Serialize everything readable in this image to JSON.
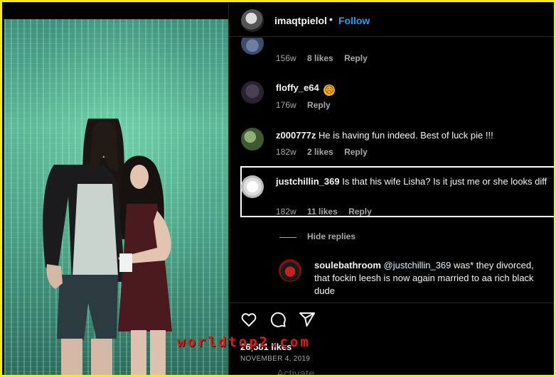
{
  "header": {
    "username": "imaqtpielol",
    "separator": "•",
    "follow_label": "Follow"
  },
  "comments": [
    {
      "meta": {
        "time": "156w",
        "likes": "8 likes",
        "reply": "Reply"
      }
    },
    {
      "username": "floffy_e64",
      "text": "☹",
      "meta": {
        "time": "176w",
        "reply": "Reply"
      }
    },
    {
      "username": "z000777z",
      "text": "He is having fun indeed. Best of luck pie !!!",
      "meta": {
        "time": "182w",
        "likes": "2 likes",
        "reply": "Reply"
      }
    },
    {
      "username": "justchillin_369",
      "text": "Is that his wife Lisha? Is it just me or she looks diff",
      "meta": {
        "time": "182w",
        "likes": "11 likes",
        "reply": "Reply"
      }
    }
  ],
  "hide_replies_label": "Hide replies",
  "reply": {
    "username": "soulebathroom",
    "mention": "@justchillin_369",
    "text": "was* they divorced, that fockin leesh is now again married to aa rich black dude"
  },
  "post": {
    "likes_count": "26,581 likes",
    "date": "NOVEMBER 4, 2019"
  },
  "watermark": "worldtop2.com",
  "os_overlay": "Activate",
  "colors": {
    "frame_border": "#f2ee12",
    "follow_blue": "#1aa0f5",
    "mention_blue": "#e0f1ff",
    "muted_text": "#a8a8a8",
    "watermark_red": "#d0211c"
  },
  "icons": [
    "heart-icon",
    "comment-icon",
    "share-icon",
    "frown-emoji"
  ]
}
